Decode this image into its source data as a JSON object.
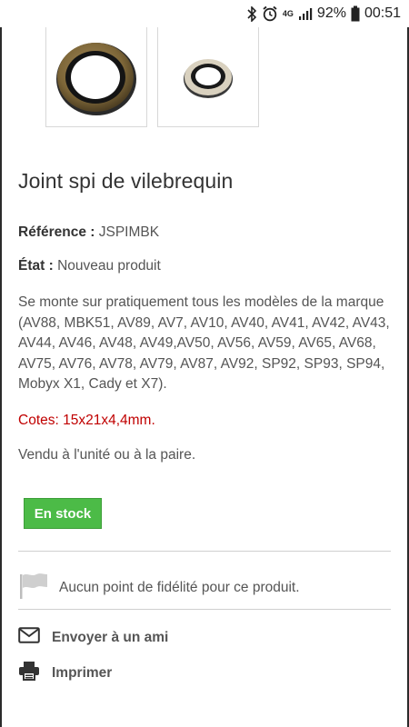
{
  "status_bar": {
    "network": "4G",
    "battery_pct": "92%",
    "time": "00:51"
  },
  "product": {
    "title": "Joint spi de vilebrequin",
    "reference_label": "Référence :",
    "reference_value": "JSPIMBK",
    "state_label": "État :",
    "state_value": "Nouveau produit",
    "description": "Se monte sur pratiquement tous les modèles de la marque (AV88, MBK51, AV89, AV7, AV10, AV40, AV41, AV42, AV43, AV44, AV46, AV48, AV49,AV50,  AV56, AV59, AV65, AV68, AV75, AV76, AV78, AV79, AV87, AV92, SP92, SP93, SP94, Mobyx X1, Cady et X7).",
    "dimensions": "Cotes: 15x21x4,4mm.",
    "sale_unit": "Vendu à l'unité ou à la paire.",
    "stock_badge": "En stock"
  },
  "loyalty": {
    "text": "Aucun point de fidélité pour ce produit."
  },
  "actions": {
    "send_friend": "Envoyer à un ami",
    "print": "Imprimer"
  },
  "icons": {
    "thumbnail_1": "oil-seal-image",
    "thumbnail_2": "oil-seal-image",
    "loyalty": "flag-icon",
    "send": "envelope-icon",
    "print": "printer-icon"
  },
  "colors": {
    "stock_badge": "#4cbb47",
    "dimensions_text": "#c00000"
  }
}
